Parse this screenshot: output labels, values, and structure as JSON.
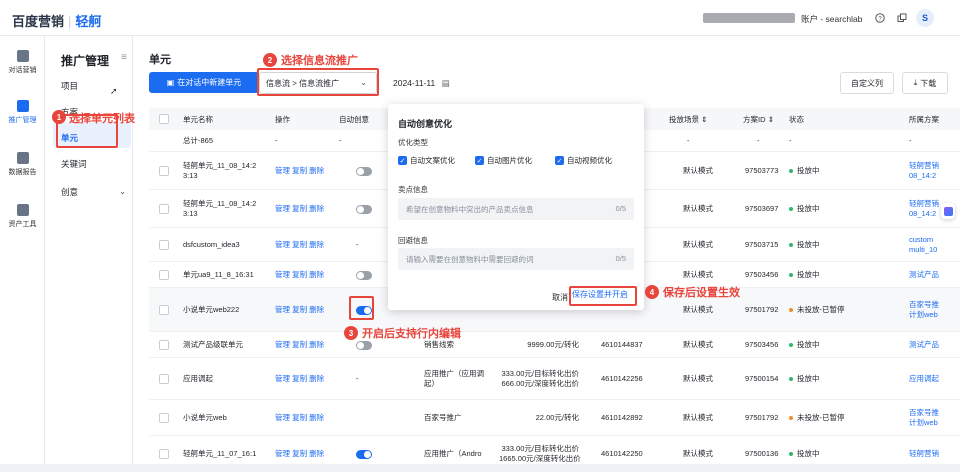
{
  "header": {
    "brand_main": "百度营销",
    "brand_sub": "轻舸",
    "account": "账户 - searchlab",
    "avatar": "S"
  },
  "rail": [
    {
      "label": "对话营销",
      "icon": "chat-chart-icon"
    },
    {
      "label": "推广管理",
      "icon": "trend-chart-icon",
      "active": true
    },
    {
      "label": "数据报告",
      "icon": "report-icon"
    },
    {
      "label": "资产工具",
      "icon": "toolbox-icon"
    }
  ],
  "subnav": {
    "title": "推广管理",
    "items": [
      "项目",
      "方案",
      "单元",
      "关键词",
      "创意"
    ]
  },
  "main": {
    "title": "单元",
    "new_button": "在对话中新建单元",
    "flow_select": "信息流 > 信息流推广",
    "date": "2024-11-11",
    "custom_columns": "自定义列",
    "download": "下载"
  },
  "table": {
    "headers": [
      "单元名称",
      "操作",
      "自动创意",
      "投放场景",
      "方案ID",
      "状态",
      "所属方案"
    ],
    "actions": "管理 复制 删除",
    "total": "总计-865",
    "rows": [
      {
        "name": "轻舸单元_11_08_14:2\n3:13",
        "toggle": "off",
        "scene": "默认模式",
        "id": "97503773",
        "status": "投放中",
        "plan": "轻舸营销\n08_14:2"
      },
      {
        "name": "轻舸单元_11_08_14:2\n3:13",
        "toggle": "off",
        "scene": "默认模式",
        "id": "97503697",
        "status": "投放中",
        "plan": "轻舸营销\n08_14:2"
      },
      {
        "name": "dsfcustom_idea3",
        "toggle": "-",
        "scene": "默认模式",
        "id": "97503715",
        "status": "投放中",
        "plan": "custom\nmulti_10"
      },
      {
        "name": "单元ua9_11_8_16:31",
        "toggle": "off",
        "scene": "默认模式",
        "id": "97503456",
        "status": "投放中",
        "plan": "测试产品"
      },
      {
        "name": "小说单元web222",
        "toggle": "on",
        "scene": "默认模式",
        "id": "97501792",
        "status": "未投放-已暂停",
        "plan": "百家号推\n计划web"
      },
      {
        "name": "测试产品级联单元",
        "toggle": "off",
        "target": "销售线索",
        "price": "9999.00元/转化",
        "planid": "4610144837",
        "scene": "默认模式",
        "id": "97503456",
        "status": "投放中",
        "plan": "测试产品"
      },
      {
        "name": "应用调起",
        "toggle": "-",
        "target": "应用推广（应用调\n起）",
        "price": "333.00元/目标转化出价\n666.00元/深度转化出价",
        "planid": "4610142256",
        "scene": "默认模式",
        "id": "97500154",
        "status": "投放中",
        "plan": "应用调起"
      },
      {
        "name": "小说单元web",
        "toggle": "",
        "target": "百家号推广",
        "price": "22.00元/转化",
        "planid": "4610142892",
        "scene": "默认模式",
        "id": "97501792",
        "status": "未投放-已暂停",
        "plan": "百家号推\n计划web"
      },
      {
        "name": "轻舸单元_11_07_16:1",
        "toggle": "on",
        "target": "应用推广（Andro",
        "price": "333.00元/目标转化出价\n1665.00元/深度转化出价",
        "planid": "4610142250",
        "scene": "默认模式",
        "id": "97500136",
        "status": "投放中",
        "plan": "轻舸营销"
      }
    ]
  },
  "popup": {
    "title": "自动创意优化",
    "type_label": "优化类型",
    "options": [
      "自动文案优化",
      "自动图片优化",
      "自动视频优化"
    ],
    "selling_label": "卖点信息",
    "selling_placeholder": "希望在创意物料中突出的产品卖点信息",
    "selling_count": "0/5",
    "avoid_label": "回避信息",
    "avoid_placeholder": "请输入需要在创意物料中需要回避的词",
    "avoid_count": "0/5",
    "cancel": "取消",
    "save": "保存设置并开启"
  },
  "annotations": [
    {
      "num": "1",
      "text": "选择单元列表"
    },
    {
      "num": "2",
      "text": "选择信息流推广"
    },
    {
      "num": "3",
      "text": "开启后支持行内编辑"
    },
    {
      "num": "4",
      "text": "保存后设置生效"
    }
  ],
  "colors": {
    "primary": "#1c6cf2",
    "annotation": "#e8453c",
    "status_on": "#2eb872",
    "status_paused": "#f08c2a"
  }
}
